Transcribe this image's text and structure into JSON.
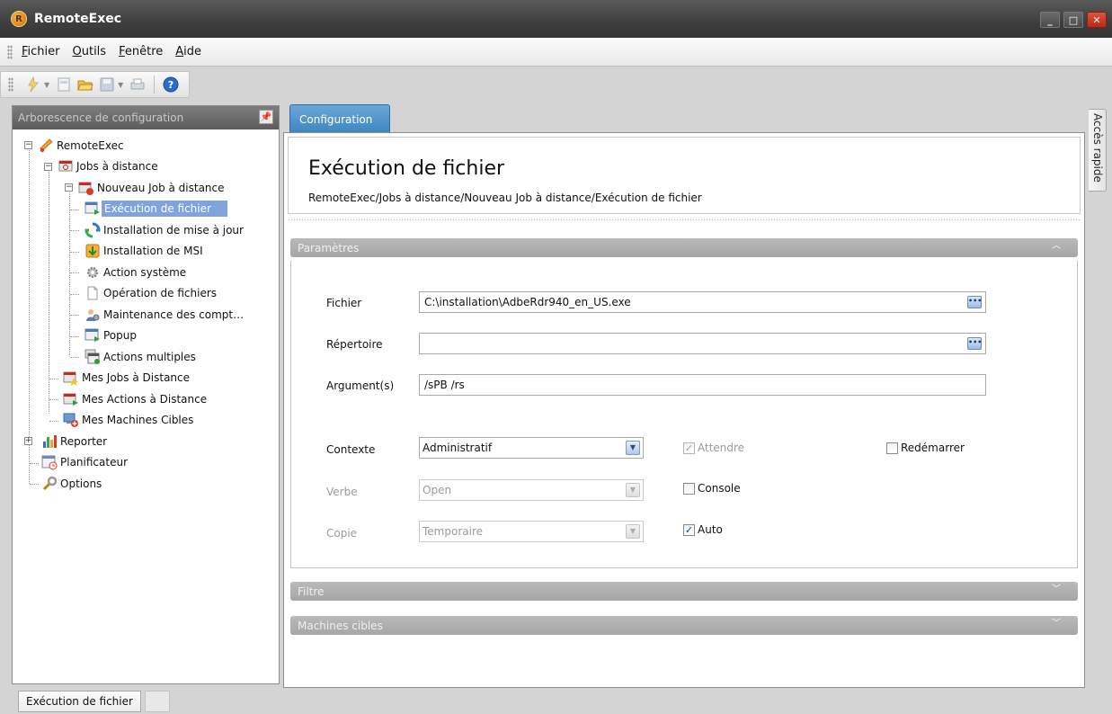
{
  "window": {
    "title": "RemoteExec"
  },
  "menu": [
    "Fichier",
    "Outils",
    "Fenêtre",
    "Aide"
  ],
  "left_panel": {
    "title": "Arborescence de configuration",
    "tree": [
      "RemoteExec",
      "Jobs à distance",
      "Nouveau Job à distance",
      "Exécution de fichier",
      "Installation de mise à jour",
      "Installation de MSI",
      "Action système",
      "Opération de fichiers",
      "Maintenance des compt…",
      "Popup",
      "Actions multiples",
      "Mes Jobs à Distance",
      "Mes Actions à Distance",
      "Mes Machines Cibles",
      "Reporter",
      "Planificateur",
      "Options"
    ]
  },
  "tab": {
    "label": "Configuration"
  },
  "header": {
    "title": "Exécution de fichier",
    "path": "RemoteExec/Jobs à distance/Nouveau Job à distance/Exécution de fichier"
  },
  "sections": {
    "params": "Paramètres",
    "filter": "Filtre",
    "targets": "Machines cibles"
  },
  "form": {
    "fichier_label": "Fichier",
    "fichier_value": "C:\\installation\\AdbeRdr940_en_US.exe",
    "repertoire_label": "Répertoire",
    "repertoire_value": "",
    "args_label": "Argument(s)",
    "args_value": "/sPB /rs",
    "contexte_label": "Contexte",
    "contexte_value": "Administratif",
    "verbe_label": "Verbe",
    "verbe_value": "Open",
    "copie_label": "Copie",
    "copie_value": "Temporaire",
    "attendre_label": "Attendre",
    "attendre_checked": true,
    "redemarrer_label": "Redémarrer",
    "redemarrer_checked": false,
    "console_label": "Console",
    "console_checked": false,
    "auto_label": "Auto",
    "auto_checked": true
  },
  "quick_access": "Accès rapide",
  "statusbar": {
    "tab": "Exécution de fichier"
  },
  "colors": {
    "accent": "#3e85c2",
    "selection": "#7fa4dd",
    "titlebar": "#3e3e3e"
  }
}
